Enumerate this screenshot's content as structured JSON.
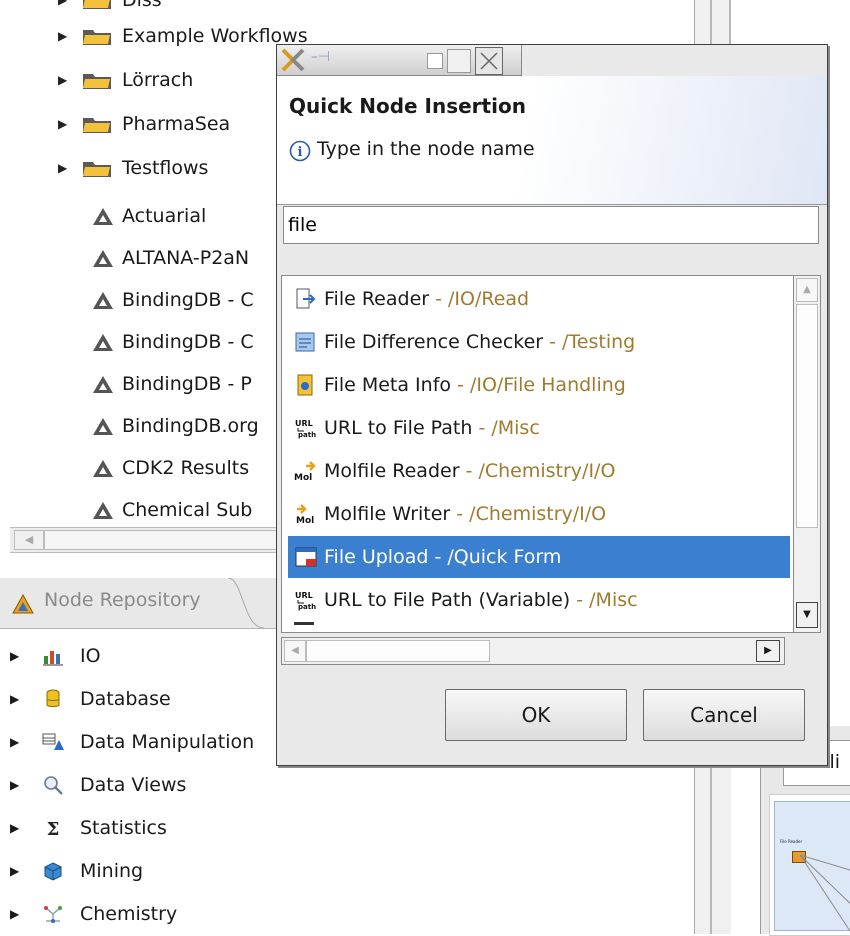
{
  "workflow_tree": {
    "partial_top": "Diss",
    "folders": [
      {
        "label": "Example Workflows"
      },
      {
        "label": "Lörrach"
      },
      {
        "label": "PharmaSea"
      },
      {
        "label": "Testflows"
      }
    ],
    "workflows": [
      {
        "label": "Actuarial"
      },
      {
        "label": "ALTANA-P2aN"
      },
      {
        "label": "BindingDB - C"
      },
      {
        "label": "BindingDB - C"
      },
      {
        "label": "BindingDB - P"
      },
      {
        "label": "BindingDB.org"
      },
      {
        "label": "CDK2 Results"
      },
      {
        "label": "Chemical Sub"
      }
    ]
  },
  "node_repository": {
    "tab_label": "Node Repository",
    "categories": [
      {
        "label": "IO",
        "icon": "io-icon"
      },
      {
        "label": "Database",
        "icon": "database-icon"
      },
      {
        "label": "Data Manipulation",
        "icon": "data-manipulation-icon"
      },
      {
        "label": "Data Views",
        "icon": "magnifier-icon"
      },
      {
        "label": "Statistics",
        "icon": "sigma-icon"
      },
      {
        "label": "Mining",
        "icon": "mining-cube-icon"
      },
      {
        "label": "Chemistry",
        "icon": "molecule-icon"
      }
    ]
  },
  "outline": {
    "tab_label_partial": "tli",
    "thumb_node_label": "File Reader"
  },
  "dialog": {
    "title": "Quick Node Insertion",
    "info_text": "Type in the node name",
    "search_value": "file",
    "results": [
      {
        "name": "File Reader",
        "path": " - /IO/Read",
        "icon": "file-reader-icon"
      },
      {
        "name": "File Difference Checker",
        "path": " - /Testing",
        "icon": "file-diff-icon"
      },
      {
        "name": "File Meta Info",
        "path": " - /IO/File Handling",
        "icon": "file-meta-icon"
      },
      {
        "name": "URL to File Path",
        "path": " - /Misc",
        "icon": "url-path-icon"
      },
      {
        "name": "Molfile Reader",
        "path": " - /Chemistry/I/O",
        "icon": "molfile-reader-icon"
      },
      {
        "name": "Molfile Writer",
        "path": " - /Chemistry/I/O",
        "icon": "molfile-writer-icon"
      },
      {
        "name": "File Upload",
        "path": " - /Quick Form",
        "icon": "file-upload-icon",
        "selected": true
      },
      {
        "name": "URL to File Path (Variable)",
        "path": " - /Misc",
        "icon": "url-path-icon"
      }
    ],
    "ok_label": "OK",
    "cancel_label": "Cancel"
  },
  "colors": {
    "selection": "#3a7fd0",
    "path_text": "#a07a2e",
    "title_band": "#dfe6f5"
  }
}
